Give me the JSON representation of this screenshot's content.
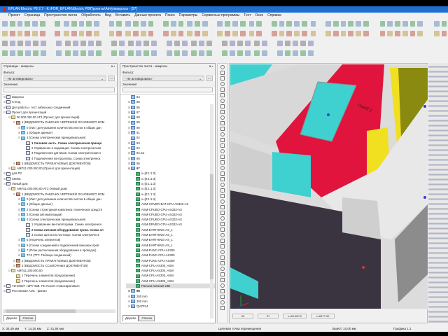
{
  "title": "EPLAN Electric P8 2.7 - K:\\FOR_EPLAN\\Electric P8\\Проекты\\Ainfy\\макросы - [97]",
  "menu": [
    "Проект",
    "Страница",
    "Пространство листа",
    "Обработать",
    "Вид",
    "Вставить",
    "Данные проекта",
    "Поиск",
    "Параметры",
    "Сервисные программы",
    "Тест",
    "Окно",
    "Справка"
  ],
  "colors": {
    "titlebar": "#1e6fd0",
    "red": "#e0143c",
    "cyan": "#3fd0d0",
    "yellow": "#f0e020",
    "olive": "#8a8a10"
  },
  "pages_panel": {
    "title": "Страницы - макросы",
    "filter_label": "Фильтр:",
    "filter_value": "- Не активировано -",
    "value_label": "Значение:",
    "tree": [
      {
        "t": "макросы",
        "d": 0,
        "pm": "+",
        "ic": "pr0"
      },
      {
        "t": "Стенд",
        "d": 0,
        "pm": "+",
        "ic": "pr0"
      },
      {
        "t": "Для работы - тест кабельных соединений",
        "d": 0,
        "pm": "+",
        "ic": "pr0"
      },
      {
        "t": "Проект для презентаций",
        "d": 0,
        "pm": "-",
        "ic": "pr0"
      },
      {
        "t": "00.000.000.00.АТ3 (Проект для презентаций)",
        "d": 1,
        "pm": "-",
        "ic": "pr"
      },
      {
        "t": "1 (ВЕДОМОСТЬ РАБОЧИХ ЧЕРТЕЖЕЙ ОСНОВНОГО КОМ",
        "d": 2,
        "pm": "-",
        "ic": "fd"
      },
      {
        "t": "0 (Лист для указания количества листов в общих дан",
        "d": 3,
        "pm": "+",
        "ic": "pg"
      },
      {
        "t": "1 (Общие данные)",
        "d": 3,
        "pm": "+",
        "ic": "pg"
      },
      {
        "t": "4 (Схема электрическая принципиальная)",
        "d": 3,
        "pm": "-",
        "ic": "pg"
      },
      {
        "t": "1 Силовая часть. Схема электрическая принци",
        "d": 4,
        "pm": "",
        "ic": "pp",
        "b": true
      },
      {
        "t": "2 Управление и индикация. Схема электрическая",
        "d": 4,
        "pm": "",
        "ic": "pp"
      },
      {
        "t": "3 Подключения датчиков. Схема электрическая п",
        "d": 4,
        "pm": "",
        "ic": "pp"
      },
      {
        "t": "4 Подключения контроллера. Схема электрическ",
        "d": 4,
        "pm": "",
        "ic": "pp"
      },
      {
        "t": "2 (ВЕДОМОСТЬ ПРИЛАГАЕМЫХ ДОКУМЕНТОВ)",
        "d": 2,
        "pm": "+",
        "ic": "fd"
      },
      {
        "t": "АМП11.000.000.00 (Проект для презентаций)",
        "d": 1,
        "pm": "+",
        "ic": "pr"
      },
      {
        "t": "для РЗ",
        "d": 0,
        "pm": "+",
        "ic": "pr0"
      },
      {
        "t": "СМИС",
        "d": 0,
        "pm": "+",
        "ic": "pr0"
      },
      {
        "t": "Умный дом",
        "d": 0,
        "pm": "-",
        "ic": "pr0"
      },
      {
        "t": "АМП11.000.000.00.АТ3 (Умный дом)",
        "d": 1,
        "pm": "-",
        "ic": "pr"
      },
      {
        "t": "1 (ВЕДОМОСТЬ РАБОЧИХ ЧЕРТЕЖЕЙ ОСНОВНОГО КОМ",
        "d": 2,
        "pm": "-",
        "ic": "fd"
      },
      {
        "t": "0 (Лист для указания количества листов в общих дан",
        "d": 3,
        "pm": "+",
        "ic": "pg"
      },
      {
        "t": "1 (Общие данные)",
        "d": 3,
        "pm": "+",
        "ic": "pg"
      },
      {
        "t": "2 (Схема структурная комплекса технических средств",
        "d": 3,
        "pm": "+",
        "ic": "pg"
      },
      {
        "t": "3 (Схема автоматизации)",
        "d": 3,
        "pm": "+",
        "ic": "pg"
      },
      {
        "t": "4 (Схема электрическая принципиальная)",
        "d": 3,
        "pm": "-",
        "ic": "pg"
      },
      {
        "t": "1 Управление вентиляторами. Схема электрическ",
        "d": 4,
        "pm": "",
        "ic": "pp"
      },
      {
        "t": "2 Схема питания оборудования кухни. Схема эл",
        "d": 4,
        "pm": "",
        "ic": "pp",
        "b": true
      },
      {
        "t": "3 Схема щитка на лестнице. Схема электрическ",
        "d": 4,
        "pm": "",
        "ic": "pp"
      },
      {
        "t": "5 (Перечень элементов)",
        "d": 3,
        "pm": "+",
        "ic": "pg"
      },
      {
        "t": "6 (Схема соединений и подключений внешних пров",
        "d": 3,
        "pm": "+",
        "ic": "pg"
      },
      {
        "t": "7 (План расположения оборудования и проводок)",
        "d": 3,
        "pm": "+",
        "ic": "pg"
      },
      {
        "t": "ТС2 (ТТТ. Таблица соединений)",
        "d": 3,
        "pm": "+",
        "ic": "pg"
      },
      {
        "t": "2 (ВЕДОМОСТЬ ПРИЛАГАЕМЫХ ДОКУМЕНТОВ)",
        "d": 2,
        "pm": "+",
        "ic": "fd"
      },
      {
        "t": "3 (ВЕДОМОСТЬ ССЫЛОЧНЫХ ДОКУМЕНТОВ)",
        "d": 2,
        "pm": "+",
        "ic": "fd"
      },
      {
        "t": "АМП11.200.000.00",
        "d": 1,
        "pm": "-",
        "ic": "pr"
      },
      {
        "t": "1 Перечень элементов (продолжение)",
        "d": 2,
        "pm": "",
        "ic": "pr"
      },
      {
        "t": "2 Перечень элементов (продолжение)",
        "d": 2,
        "pm": "",
        "ic": "pr"
      },
      {
        "t": "ТИ-20027 «ЗРУ-6кВ. ПС №123 «Новосаратовка»",
        "d": 0,
        "pm": "+",
        "ic": "pr0"
      },
      {
        "t": "Ростовская АЭС - финал",
        "d": 0,
        "pm": "+",
        "ic": "pr0"
      }
    ],
    "tabs": [
      "Дерево",
      "Список"
    ]
  },
  "layout_panel": {
    "title": "Пространство листа - макросы",
    "filter_label": "Фильтр:",
    "filter_value": "- Не активировано -",
    "value_label": "Значение:",
    "tree": [
      {
        "t": "84",
        "d": 0,
        "pm": "",
        "ic": "sp"
      },
      {
        "t": "85",
        "d": 0,
        "pm": "+",
        "ic": "sp"
      },
      {
        "t": "86",
        "d": 0,
        "pm": "+",
        "ic": "sp"
      },
      {
        "t": "87",
        "d": 0,
        "pm": "+",
        "ic": "sp"
      },
      {
        "t": "88",
        "d": 0,
        "pm": "+",
        "ic": "sp"
      },
      {
        "t": "89",
        "d": 0,
        "pm": "+",
        "ic": "sp"
      },
      {
        "t": "90",
        "d": 0,
        "pm": "+",
        "ic": "sp"
      },
      {
        "t": "91",
        "d": 0,
        "pm": "+",
        "ic": "sp"
      },
      {
        "t": "92",
        "d": 0,
        "pm": "",
        "ic": "sp"
      },
      {
        "t": "93",
        "d": 0,
        "pm": "+",
        "ic": "sp"
      },
      {
        "t": "94",
        "d": 0,
        "pm": "+",
        "ic": "sp"
      },
      {
        "t": "94.1ж",
        "d": 0,
        "pm": "+",
        "ic": "sp"
      },
      {
        "t": "95",
        "d": 0,
        "pm": "+",
        "ic": "sp"
      },
      {
        "t": "96",
        "d": 0,
        "pm": "+",
        "ic": "sp"
      },
      {
        "t": "97",
        "d": 0,
        "pm": "-",
        "ic": "sp",
        "b": true
      },
      {
        "t": "x=[0:1:1:3]",
        "d": 1,
        "pm": "",
        "ic": "mc"
      },
      {
        "t": "x=[0:1:1:3]",
        "d": 1,
        "pm": "",
        "ic": "mc"
      },
      {
        "t": "x=[0:1:1:3]",
        "d": 1,
        "pm": "",
        "ic": "mc"
      },
      {
        "t": "x=[0:1:1:3]",
        "d": 1,
        "pm": "",
        "ic": "mc"
      },
      {
        "t": "x=[0:1:1:3]",
        "d": 1,
        "pm": "",
        "ic": "mc"
      },
      {
        "t": "x=[0:1:1:4]",
        "d": 1,
        "pm": "",
        "ic": "mc"
      },
      {
        "t": "ASM-COVER-BAT-CPU-AS332-AS",
        "d": 1,
        "pm": "",
        "ic": "mc"
      },
      {
        "t": "ASM-CPUBO-CPU-AS332-AS",
        "d": 1,
        "pm": "",
        "ic": "mc"
      },
      {
        "t": "ASM-CPUBO-CPU-AS332-AS",
        "d": 1,
        "pm": "",
        "ic": "mc"
      },
      {
        "t": "ASM-CPUBO-CPU-AS332-AS",
        "d": 1,
        "pm": "",
        "ic": "mc"
      },
      {
        "t": "ASM-DRVBO-CPU-AS332-AS",
        "d": 1,
        "pm": "",
        "ic": "mc"
      },
      {
        "t": "ASM-EARTHING-AS_1",
        "d": 1,
        "pm": "",
        "ic": "mc"
      },
      {
        "t": "ASM-EARTHING-AS_1",
        "d": 1,
        "pm": "",
        "ic": "mc"
      },
      {
        "t": "ASM-EARTHING-AS_1",
        "d": 1,
        "pm": "",
        "ic": "mc"
      },
      {
        "t": "ASM-EARTHING-AS_1",
        "d": 1,
        "pm": "",
        "ic": "mc"
      },
      {
        "t": "ASM-FUNC-CPU-AS300",
        "d": 1,
        "pm": "",
        "ic": "mc"
      },
      {
        "t": "ASM-FUNC-CPU-AS300",
        "d": 1,
        "pm": "",
        "ic": "mc"
      },
      {
        "t": "ASM-FUNC-CPU-AS300",
        "d": 1,
        "pm": "",
        "ic": "mc"
      },
      {
        "t": "ASM-CPU-AS300_ASM",
        "d": 1,
        "pm": "",
        "ic": "mc"
      },
      {
        "t": "ASM-CPU-AS300_ASM",
        "d": 1,
        "pm": "",
        "ic": "mc"
      },
      {
        "t": "ASM-CPU-AS300_ASM",
        "d": 1,
        "pm": "",
        "ic": "mc"
      },
      {
        "t": "ASM-CPU-AS300_ASM",
        "d": 1,
        "pm": "",
        "ic": "mc"
      },
      {
        "t": "Разъем питания 24В",
        "d": 1,
        "pm": "",
        "ic": "mc",
        "hl": true
      },
      {
        "t": "98",
        "d": 0,
        "pm": "+",
        "ic": "sp",
        "b": true
      },
      {
        "t": "200 mm",
        "d": 0,
        "pm": "+",
        "ic": "sp"
      },
      {
        "t": "300 mm",
        "d": 0,
        "pm": "+",
        "ic": "sp"
      },
      {
        "t": "QVZP14",
        "d": 0,
        "pm": "+",
        "ic": "sp"
      }
    ],
    "tabs": [
      "Дерево",
      "Список"
    ]
  },
  "viewport": {
    "field1": "90",
    "field2": "97",
    "coord1": "x=60,000.0",
    "coord2": "x=6977.00",
    "label": "Ошиб 2"
  },
  "status": {
    "x": "X: 34,49 мм",
    "y": "Y: 14,25 мм",
    "z": "Z: 41,94 мм",
    "hint": "Целевая точка перемещения",
    "grid": "ВЫКЛ: 10,00 мм",
    "scale": "Графика 1:1"
  }
}
